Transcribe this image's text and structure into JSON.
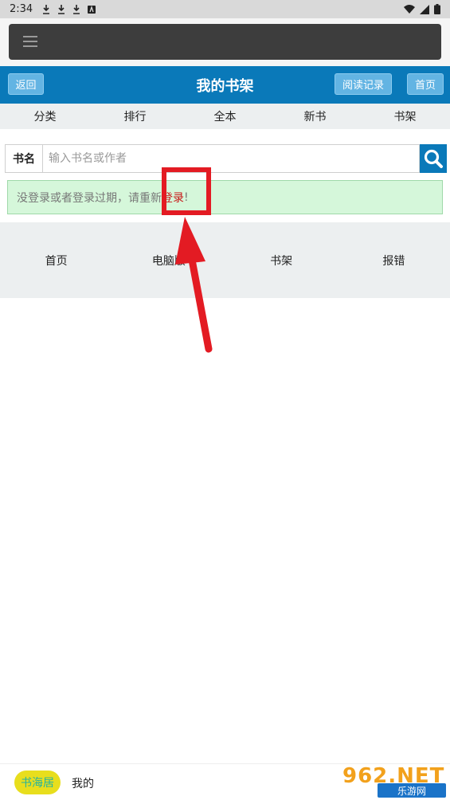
{
  "status_bar": {
    "time": "2:34",
    "icons": [
      "download-icon",
      "download-icon",
      "download-icon",
      "app-notification-icon"
    ],
    "right_icons": [
      "wifi-icon",
      "signal-icon",
      "battery-icon"
    ]
  },
  "header": {
    "back_label": "返回",
    "title": "我的书架",
    "history_label": "阅读记录",
    "home_label": "首页"
  },
  "nav": {
    "items": [
      "分类",
      "排行",
      "全本",
      "新书",
      "书架"
    ]
  },
  "search": {
    "label": "书名",
    "placeholder": "输入书名或作者",
    "value": ""
  },
  "alert": {
    "text": "没登录或者登录过期，请重新",
    "link": "登录",
    "suffix": "!"
  },
  "footer": {
    "items": [
      "首页",
      "电脑版",
      "书架",
      "报错"
    ]
  },
  "bottom_bar": {
    "app_label": "书海居",
    "mine_label": "我的"
  },
  "watermark": {
    "top": "962.NET",
    "bottom": "乐游网"
  },
  "colors": {
    "header": "#0a79b9",
    "button": "#63b4e3",
    "alert_bg": "#d5f7da",
    "alert_link": "#c81616",
    "annotation": "#e31b23"
  }
}
